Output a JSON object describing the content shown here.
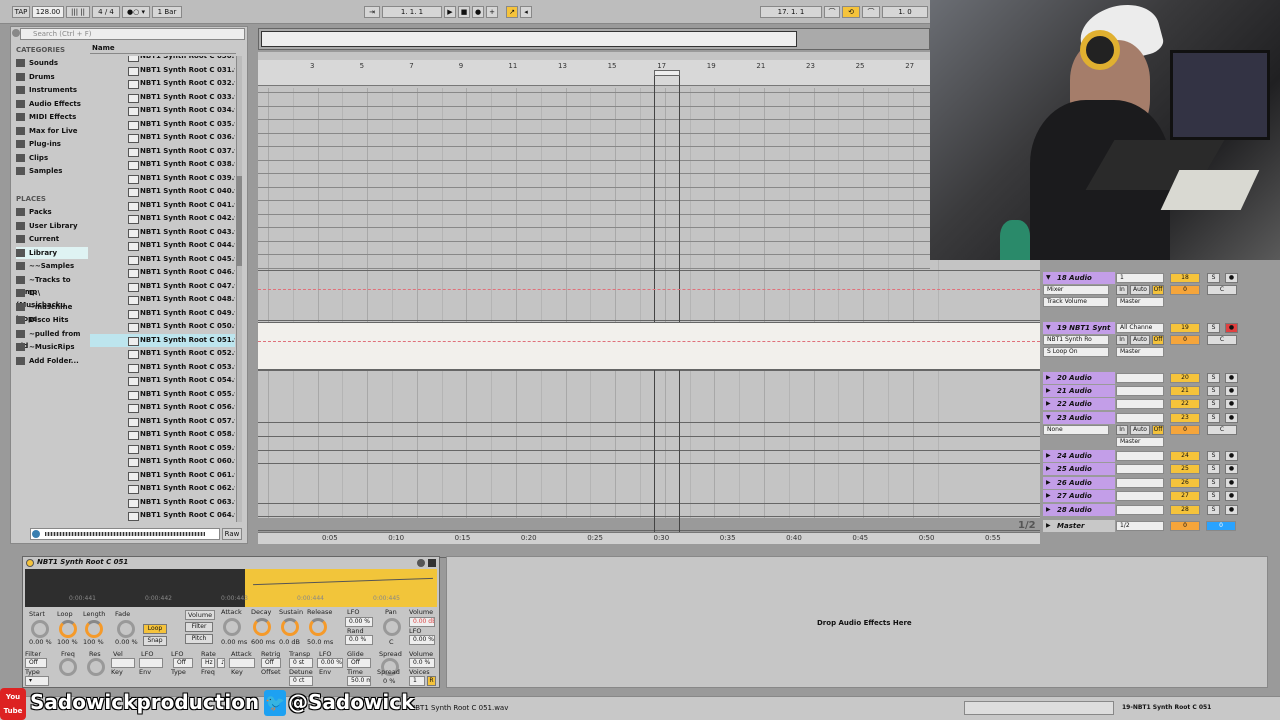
{
  "toolbar": {
    "tap": "TAP",
    "tempo": "128.00",
    "sig": "4 / 4",
    "quant": "1 Bar",
    "position": "1.    1.    1",
    "loop_start": "17.    1.    1",
    "loop_len": "1.    0"
  },
  "browser": {
    "search_placeholder": "Search (Ctrl + F)",
    "categories_title": "CATEGORIES",
    "categories": [
      "Sounds",
      "Drums",
      "Instruments",
      "Audio Effects",
      "MIDI Effects",
      "Max for Live",
      "Plug-ins",
      "Clips",
      "Samples"
    ],
    "places_title": "PLACES",
    "places": [
      "Packs",
      "User Library",
      "Current Project",
      "Library",
      "~~Samples",
      "~Tracks to samp",
      "D:\\ (Musicbacku",
      "~maschine loops",
      "Disco Hits",
      "~pulled from old",
      "~MusicRips",
      "Add Folder..."
    ],
    "column_name": "Name",
    "files": [
      "NBT1 Synth Root C 030.wav",
      "NBT1 Synth Root C 031.wav",
      "NBT1 Synth Root C 032.wav",
      "NBT1 Synth Root C 033.wav",
      "NBT1 Synth Root C 034.wav",
      "NBT1 Synth Root C 035.wav",
      "NBT1 Synth Root C 036.wav",
      "NBT1 Synth Root C 037.wav",
      "NBT1 Synth Root C 038.wav",
      "NBT1 Synth Root C 039.wav",
      "NBT1 Synth Root C 040.wav",
      "NBT1 Synth Root C 041.wav",
      "NBT1 Synth Root C 042.wav",
      "NBT1 Synth Root C 043.wav",
      "NBT1 Synth Root C 044.wav",
      "NBT1 Synth Root C 045.wav",
      "NBT1 Synth Root C 046.wav",
      "NBT1 Synth Root C 047.wav",
      "NBT1 Synth Root C 048.wav",
      "NBT1 Synth Root C 049.wav",
      "NBT1 Synth Root C 050.wav",
      "NBT1 Synth Root C 051.wav",
      "NBT1 Synth Root C 052.wav",
      "NBT1 Synth Root C 053.wav",
      "NBT1 Synth Root C 054.wav",
      "NBT1 Synth Root C 055.wav",
      "NBT1 Synth Root C 056.wav",
      "NBT1 Synth Root C 057.wav",
      "NBT1 Synth Root C 058.wav",
      "NBT1 Synth Root C 059.wav",
      "NBT1 Synth Root C 060.wav",
      "NBT1 Synth Root C 061.wav",
      "NBT1 Synth Root C 062.wav",
      "NBT1 Synth Root C 063.wav",
      "NBT1 Synth Root C 064.wav"
    ],
    "selected_file_index": 21,
    "raw_label": "Raw"
  },
  "ruler": {
    "bars": [
      "3",
      "5",
      "7",
      "9",
      "11",
      "13",
      "15",
      "17",
      "19",
      "21",
      "23",
      "25",
      "27"
    ],
    "times": [
      "0:05",
      "0:10",
      "0:15",
      "0:20",
      "0:25",
      "0:30",
      "0:35",
      "0:40",
      "0:45",
      "0:50",
      "0:55"
    ]
  },
  "tracks": [
    {
      "name": "18 Audio",
      "num": "18",
      "open": true,
      "dd1": "Mixer",
      "dd2": "Track Volume",
      "route": "Master",
      "in": "1"
    },
    {
      "name": "19 NBT1 Synt",
      "num": "19",
      "open": true,
      "dd1": "NBT1 Synth Ro",
      "dd2": "S Loop On",
      "route": "Master",
      "in": "All Channe"
    },
    {
      "name": "20 Audio",
      "num": "20",
      "open": false
    },
    {
      "name": "21 Audio",
      "num": "21",
      "open": false
    },
    {
      "name": "22 Audio",
      "num": "22",
      "open": false
    },
    {
      "name": "23 Audio",
      "num": "23",
      "open": true,
      "dd1": "None",
      "route": "Master"
    },
    {
      "name": "24 Audio",
      "num": "24",
      "open": false
    },
    {
      "name": "25 Audio",
      "num": "25",
      "open": false
    },
    {
      "name": "26 Audio",
      "num": "26",
      "open": false
    },
    {
      "name": "27 Audio",
      "num": "27",
      "open": false
    },
    {
      "name": "28 Audio",
      "num": "28",
      "open": false
    }
  ],
  "master": {
    "name": "Master",
    "page": "1/2",
    "route": "1/2",
    "vol": "0"
  },
  "mixer": {
    "in": "In",
    "auto": "Auto",
    "off": "Off",
    "s": "S",
    "c": "C",
    "zero": "0"
  },
  "sampler": {
    "title": "NBT1 Synth Root C 051",
    "wave_times": [
      "0:00:441",
      "0:00:442",
      "0:00:443",
      "0:00:444",
      "0:00:445"
    ],
    "labels": {
      "start": "Start",
      "loop": "Loop",
      "length": "Length",
      "fade": "Fade",
      "volume": "Volume",
      "attack": "Attack",
      "decay": "Decay",
      "sustain": "Sustain",
      "release": "Release",
      "lfo": "LFO",
      "rand": "Rand",
      "pan": "Pan",
      "vol": "Volume",
      "filter": "Filter",
      "freq": "Freq",
      "res": "Res",
      "type": "Type",
      "vel": "Vel",
      "key": "Key",
      "env": "Env",
      "rate": "Rate",
      "retrig": "Retrig",
      "offset": "Offset",
      "transp": "Transp",
      "detune": "Detune",
      "glide": "Glide",
      "time": "Time",
      "spread": "Spread",
      "voices": "Voices"
    },
    "values": {
      "start": "0.00 %",
      "loop": "100 %",
      "length": "100 %",
      "fade": "0.00 %",
      "attack": "0.00 ms",
      "decay": "600 ms",
      "sustain": "0.0 dB",
      "release": "50.0 ms",
      "lfo": "0.00 %",
      "rand": "0.0 %",
      "pan": "C",
      "vol": "0.00 dB",
      "lfo_vol": "0.00 %",
      "off": "Off",
      "hz": "Hz",
      "transp": "0 st",
      "detune": "0 ct",
      "lfo2": "0.00 %",
      "glide": "Off",
      "time": "50.0 ms",
      "spread": "0 %",
      "voices": "1",
      "r": "R"
    },
    "buttons": {
      "loop": "Loop",
      "snap": "Snap",
      "filter": "Filter",
      "pitch": "Pitch"
    }
  },
  "fx": {
    "drop": "Drop Audio Effects Here"
  },
  "status": {
    "file": "NBT1 Synth Root C 051.wav",
    "track": "19-NBT1 Synth Root C 051"
  },
  "overlay": {
    "youtube_label": "You Tube",
    "channel": "Sadowickproduction",
    "twitter": "@Sadowick"
  },
  "colors": {
    "accent": "#f5c33b",
    "track": "#c39ee8",
    "knob": "#f59a2a"
  }
}
